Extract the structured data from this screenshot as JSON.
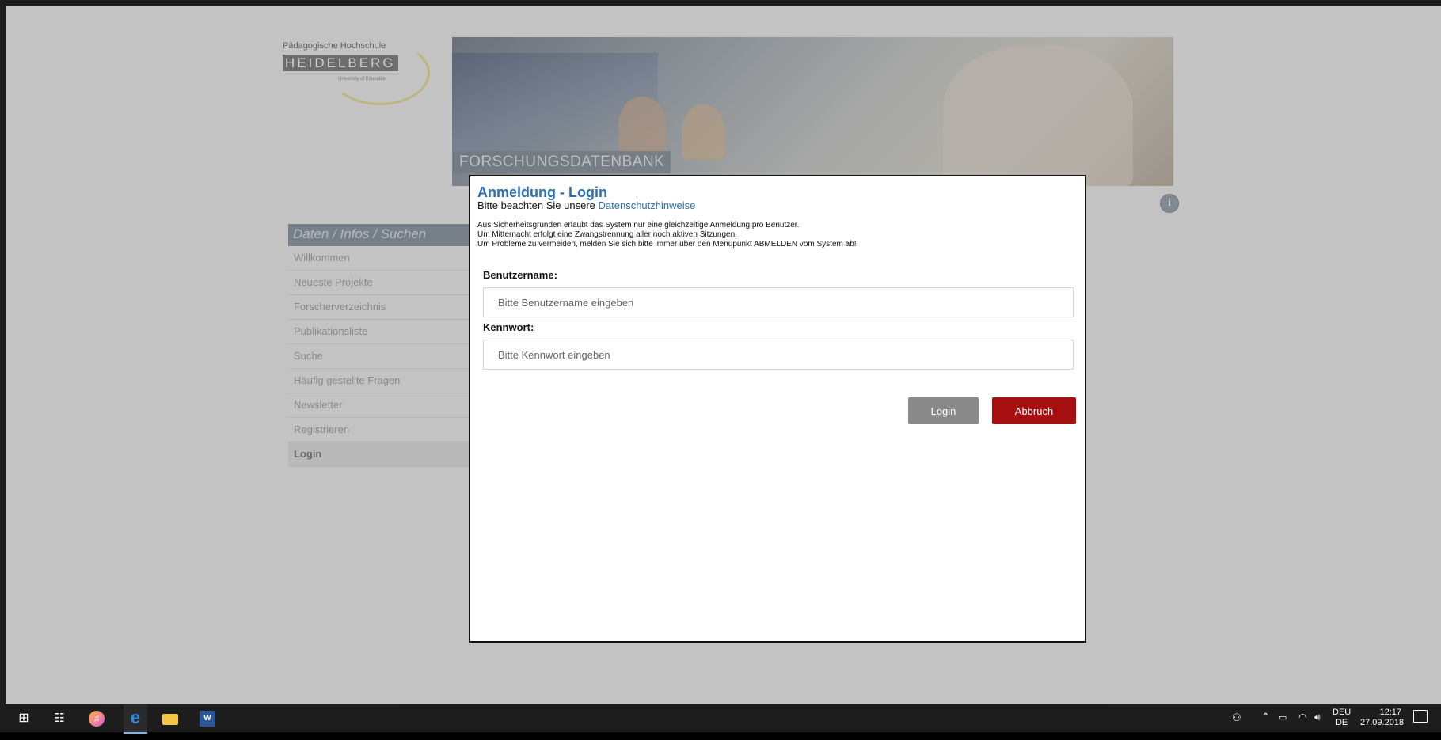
{
  "header": {
    "logo": {
      "university": "Pädagogische Hochschule",
      "name": "HEIDELBERG",
      "subtitle": "University of Education"
    },
    "banner_label": "FORSCHUNGSDATENBANK",
    "info_icon": "info-icon"
  },
  "sidebar": {
    "heading": "Daten / Infos / Suchen",
    "items": [
      {
        "label": "Willkommen"
      },
      {
        "label": "Neueste Projekte"
      },
      {
        "label": "Forscherverzeichnis"
      },
      {
        "label": "Publikationsliste"
      },
      {
        "label": "Suche"
      },
      {
        "label": "Häufig gestellte Fragen"
      },
      {
        "label": "Newsletter"
      },
      {
        "label": "Registrieren"
      },
      {
        "label": "Login",
        "active": true
      }
    ]
  },
  "modal": {
    "title": "Anmeldung - Login",
    "privacy_prefix": "Bitte beachten Sie unsere",
    "privacy_link": "Datenschutzhinweise",
    "messages": [
      "Aus Sicherheitsgründen erlaubt das System nur eine gleichzeitige Anmeldung pro Benutzer.",
      "Um Mitternacht erfolgt eine Zwangstrennung aller noch aktiven Sitzungen.",
      "Um Probleme zu vermeiden, melden Sie sich bitte immer über den Menüpunkt ABMELDEN vom System ab!"
    ],
    "username_label": "Benutzername:",
    "username_placeholder": "Bitte Benutzername eingeben",
    "username_value": "",
    "password_label": "Kennwort:",
    "password_placeholder": "Bitte Kennwort eingeben",
    "password_value": "",
    "login_button": "Login",
    "cancel_button": "Abbruch",
    "colors": {
      "title": "#2d6fb3",
      "login_button": "#8a8a8a",
      "cancel_button": "#a50f0f"
    }
  },
  "taskbar": {
    "apps": [
      "windows-start-icon",
      "task-view-icon",
      "itunes-icon",
      "edge-icon",
      "file-explorer-icon",
      "word-icon"
    ],
    "edge_glyph": "e",
    "word_glyph": "W",
    "language_top": "DEU",
    "language_bottom": "DE",
    "time": "12:17",
    "date": "27.09.2018"
  }
}
